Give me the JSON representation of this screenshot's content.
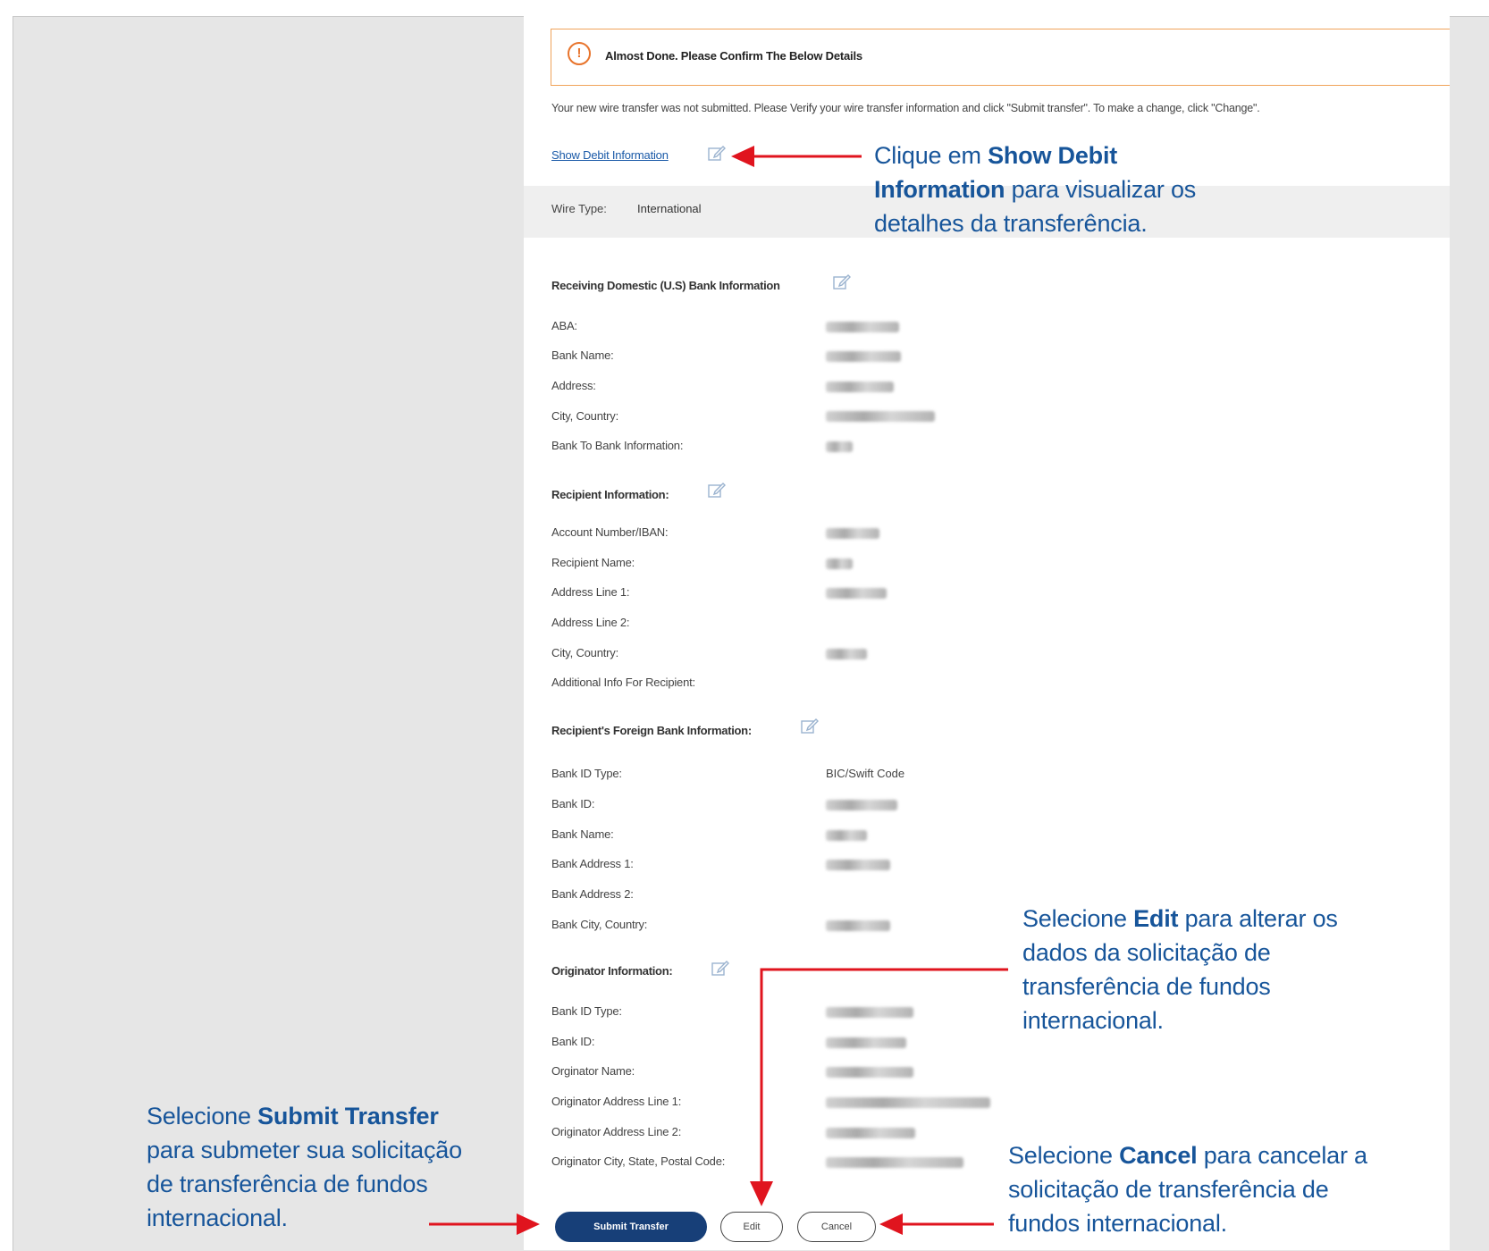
{
  "alert": {
    "icon": "exclamation-icon",
    "title": "Almost Done. Please Confirm The Below Details"
  },
  "info_text": "Your new wire transfer was not submitted. Please Verify your wire transfer information and click \"Submit transfer\". To make a change, click \"Change\".",
  "show_debit_link": "Show Debit Information",
  "wire": {
    "label": "Wire Type:",
    "value": "International"
  },
  "sections": {
    "receiving": {
      "title": "Receiving Domestic (U.S) Bank Information",
      "rows": [
        "ABA:",
        "Bank Name:",
        "Address:",
        "City, Country:",
        "Bank To Bank Information:"
      ]
    },
    "recipient": {
      "title": "Recipient Information:",
      "rows": [
        "Account Number/IBAN:",
        "Recipient Name:",
        "Address Line 1:",
        "Address Line 2:",
        "City, Country:",
        "Additional Info For Recipient:"
      ]
    },
    "foreign": {
      "title": "Recipient's Foreign Bank Information:",
      "rows": [
        "Bank ID Type:",
        "Bank ID:",
        "Bank Name:",
        "Bank Address 1:",
        "Bank Address 2:",
        "Bank City, Country:"
      ],
      "bank_id_type_value": "BIC/Swift Code"
    },
    "originator": {
      "title": "Originator Information:",
      "rows": [
        "Bank ID Type:",
        "Bank ID:",
        "Orginator Name:",
        "Originator Address Line 1:",
        "Originator Address Line 2:",
        "Originator City, State, Postal Code:"
      ]
    }
  },
  "buttons": {
    "submit": "Submit Transfer",
    "edit": "Edit",
    "cancel": "Cancel"
  },
  "annotations": {
    "show_debit": {
      "pre": "Clique em ",
      "bold": "Show Debit Information",
      "post": " para visualizar os detalhes da transferência."
    },
    "edit": {
      "pre": "Selecione ",
      "bold": "Edit",
      "post": " para alterar os dados da solicitação de transferência de fundos internacional."
    },
    "submit": {
      "pre": "Selecione ",
      "bold": "Submit Transfer",
      "post": " para submeter sua solicitação de transferência de fundos internacional."
    },
    "cancel": {
      "pre": "Selecione ",
      "bold": "Cancel",
      "post": " para cancelar a solicitação de transferência de fundos internacional."
    }
  },
  "colors": {
    "annotation": "#17559a",
    "arrow": "#e0141e",
    "primary_button": "#173f78",
    "alert_border": "#f0a35a"
  }
}
